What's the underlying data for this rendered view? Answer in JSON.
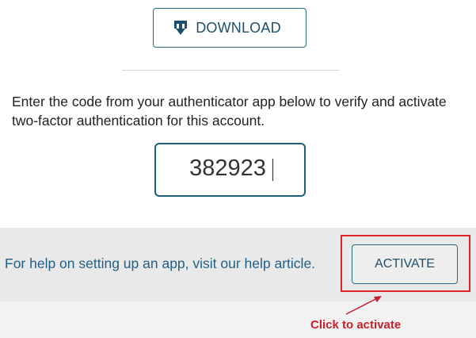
{
  "download_button": {
    "label": "DOWNLOAD",
    "icon": "download-icon"
  },
  "instructions": "Enter the code from your authenticator app below to verify and activate two-factor authentication for this account.",
  "code_input": {
    "value": "382923"
  },
  "footer": {
    "help_text": "For help on setting up an app, visit our help article.",
    "activate_label": "ACTIVATE"
  },
  "annotation": {
    "label": "Click to activate",
    "color": "#c8202a"
  },
  "colors": {
    "accent": "#1f5f7a",
    "link": "#1f5f88",
    "footer_bg": "#e9e9e9",
    "highlight": "#e0242c"
  }
}
